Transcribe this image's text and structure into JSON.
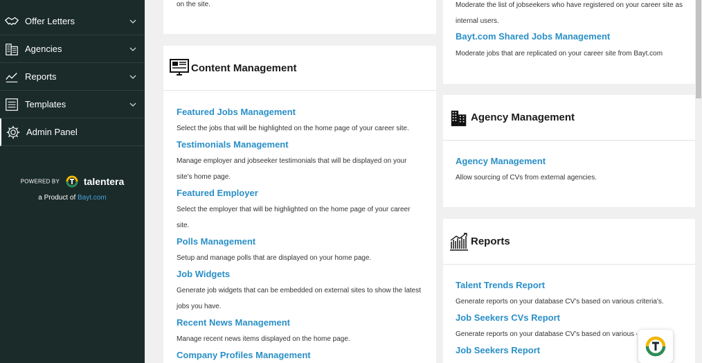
{
  "sidebar": {
    "items": [
      {
        "label": "Offer Letters",
        "icon": "handshake-icon",
        "expandable": true
      },
      {
        "label": "Agencies",
        "icon": "building-icon",
        "expandable": true
      },
      {
        "label": "Reports",
        "icon": "line-chart-icon",
        "expandable": true
      },
      {
        "label": "Templates",
        "icon": "document-icon",
        "expandable": true
      },
      {
        "label": "Admin Panel",
        "icon": "gear-icon",
        "expandable": false
      }
    ],
    "powered_by": "POWERED BY",
    "brand": "talentera",
    "product_prefix": "a Product of",
    "product_link": "Bayt.com"
  },
  "top_left_card": {
    "desc_tail": "on the site."
  },
  "top_right_card": {
    "desc_tail_line1": "Moderate the list of jobseekers who have registered on your career site as",
    "desc_tail_line2": "internal users.",
    "link": "Bayt.com Shared Jobs Management",
    "link_desc": "Moderate jobs that are replicated on your career site from Bayt.com"
  },
  "content_management": {
    "title": "Content Management",
    "icon": "monitor-icon",
    "items": [
      {
        "link": "Featured Jobs Management",
        "desc": [
          "Select the jobs that will be highlighted on the home page of your career site."
        ]
      },
      {
        "link": "Testimonials Management",
        "desc": [
          "Manage employer and jobseeker testimonials that will be displayed on your",
          "site's home page."
        ]
      },
      {
        "link": "Featured Employer",
        "desc": [
          "Select the employer that will be highlighted on the home page of your career",
          "site."
        ]
      },
      {
        "link": "Polls Management",
        "desc": [
          "Setup and manage polls that are displayed on your home page."
        ]
      },
      {
        "link": "Job Widgets",
        "desc": [
          "Generate job widgets that can be embedded on external sites to show the latest",
          "jobs you have."
        ]
      },
      {
        "link": "Recent News Management",
        "desc": [
          "Manage recent news items displayed on the home page."
        ]
      },
      {
        "link": "Company Profiles Management",
        "desc": []
      }
    ]
  },
  "agency_management": {
    "title": "Agency Management",
    "icon": "building-icon",
    "items": [
      {
        "link": "Agency Management",
        "desc": "Allow sourcing of CVs from external agencies."
      }
    ]
  },
  "reports": {
    "title": "Reports",
    "icon": "bar-chart-icon",
    "items": [
      {
        "link": "Talent Trends Report",
        "desc": "Generate reports on your database CV's based on various criteria's."
      },
      {
        "link": "Job Seekers CVs Report",
        "desc": "Generate reports on your database CV's based on various criteria's."
      },
      {
        "link": "Job Seekers Report",
        "desc": ""
      }
    ]
  },
  "colors": {
    "sidebar_bg": "#1a2b29",
    "link": "#2a8fc7",
    "accent_yellow": "#f2b705",
    "accent_green": "#2e8b57"
  }
}
